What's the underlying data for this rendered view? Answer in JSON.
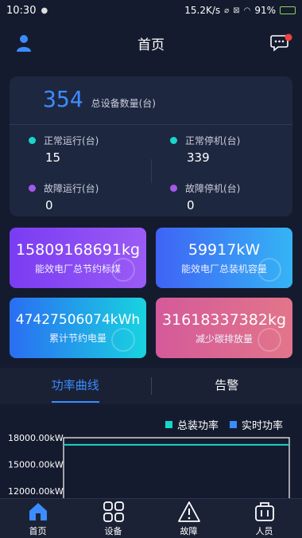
{
  "status_bar": {
    "time": "10:30",
    "network_speed": "15.2K/s",
    "battery": "91%",
    "battery_level": 0.91
  },
  "header": {
    "title": "首页"
  },
  "summary": {
    "total_value": "354",
    "total_label": "总设备数量(台)",
    "stats": [
      {
        "label": "正常运行(台)",
        "value": "15",
        "color": "#18d6c8"
      },
      {
        "label": "正常停机(台)",
        "value": "339",
        "color": "#18d6c8"
      },
      {
        "label": "故障运行(台)",
        "value": "0",
        "color": "#a35ae8"
      },
      {
        "label": "故障停机(台)",
        "value": "0",
        "color": "#a35ae8"
      }
    ]
  },
  "tiles": [
    {
      "value": "15809168691kg",
      "label": "能效电厂总节约标煤"
    },
    {
      "value": "59917kW",
      "label": "能效电厂总装机容量"
    },
    {
      "value": "47427506074kWh",
      "label": "累计节约电量"
    },
    {
      "value": "31618337382kg",
      "label": "减少碳排放量"
    }
  ],
  "tabs": [
    {
      "label": "功率曲线",
      "active": true
    },
    {
      "label": "告警",
      "active": false
    }
  ],
  "chart_data": {
    "type": "line",
    "series": [
      {
        "name": "总装功率",
        "color": "#18d6c8",
        "values": [
          17200,
          17200
        ]
      },
      {
        "name": "实时功率",
        "color": "#3b8cff",
        "values": []
      }
    ],
    "y_ticks": [
      "18000.00kW",
      "15000.00kW",
      "12000.00kW"
    ],
    "ylim": [
      11000,
      18000
    ]
  },
  "bottom_nav": [
    {
      "label": "首页",
      "icon": "home-icon",
      "active": true
    },
    {
      "label": "设备",
      "icon": "device-grid-icon",
      "active": false
    },
    {
      "label": "故障",
      "icon": "warning-icon",
      "active": false
    },
    {
      "label": "人员",
      "icon": "people-icon",
      "active": false
    }
  ],
  "colors": {
    "accent": "#3b8cff",
    "background": "#151b2e",
    "card": "#1e2740"
  }
}
